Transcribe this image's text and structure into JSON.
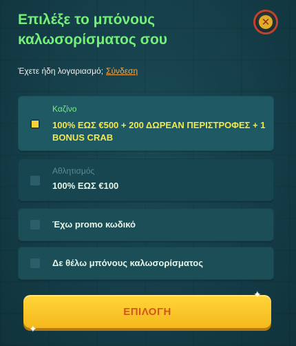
{
  "header": {
    "title": "Επιλέξε το μπόνους καλωσορίσματος σου",
    "close_icon": "close-icon"
  },
  "account": {
    "text": "Έχετε ήδη λογαριασμό;",
    "link": "Σύνδεση"
  },
  "options": [
    {
      "subtitle": "Καζίνο",
      "label": "100% ΕΩΣ €500 + 200 ΔΩΡΕΑΝ ΠΕΡΙΣΤΡΟΦΕΣ + 1 BONUS CRAB",
      "state": "selected"
    },
    {
      "subtitle": "Αθλητισμός",
      "label": "100% ΕΩΣ €100",
      "state": "disabled"
    },
    {
      "subtitle": "",
      "label": "Έχω promo κωδικό",
      "state": "default"
    },
    {
      "subtitle": "",
      "label": "Δε θέλω μπόνους καλωσορίσματος",
      "state": "default"
    }
  ],
  "submit": {
    "label": "ΕΠΙΛΟΓΗ"
  },
  "colors": {
    "accent_green": "#74f07a",
    "selected_yellow": "#f5e84b",
    "button_yellow": "#ffd63a",
    "link_orange": "#f7a84a"
  }
}
